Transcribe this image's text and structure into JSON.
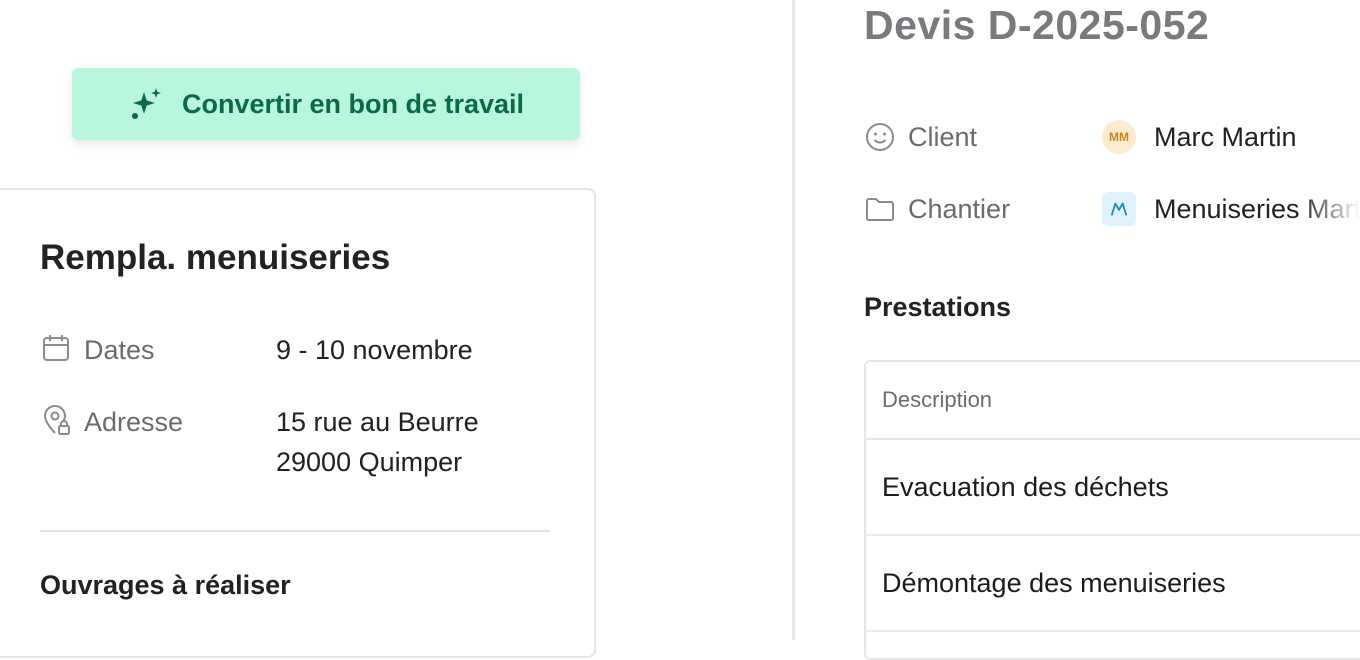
{
  "left": {
    "convert_button": {
      "label": "Convertir en bon de travail",
      "icon": "sparkles-icon"
    },
    "card": {
      "title": "Rempla. menuiseries",
      "dates": {
        "label": "Dates",
        "value": "9 - 10 novembre",
        "icon": "calendar-icon"
      },
      "address": {
        "label": "Adresse",
        "line1": "15 rue au Beurre",
        "line2": "29000 Quimper",
        "icon": "location-pin-icon"
      },
      "section_title": "Ouvrages à réaliser"
    }
  },
  "right": {
    "title": "Devis D-2025-052",
    "client": {
      "label": "Client",
      "avatar_initials": "MM",
      "value": "Marc Martin",
      "icon": "smiley-icon"
    },
    "site": {
      "label": "Chantier",
      "value": "Menuiseries Martin",
      "icon": "folder-icon"
    },
    "services": {
      "title": "Prestations",
      "columns": [
        "Description"
      ],
      "rows": [
        "Evacuation des déchets",
        "Démontage des menuiseries"
      ]
    }
  },
  "colors": {
    "accent_bg": "#b8f7dc",
    "accent_text": "#0b6a43",
    "avatar_bg": "#fdebd0",
    "avatar_text": "#c9861a"
  }
}
